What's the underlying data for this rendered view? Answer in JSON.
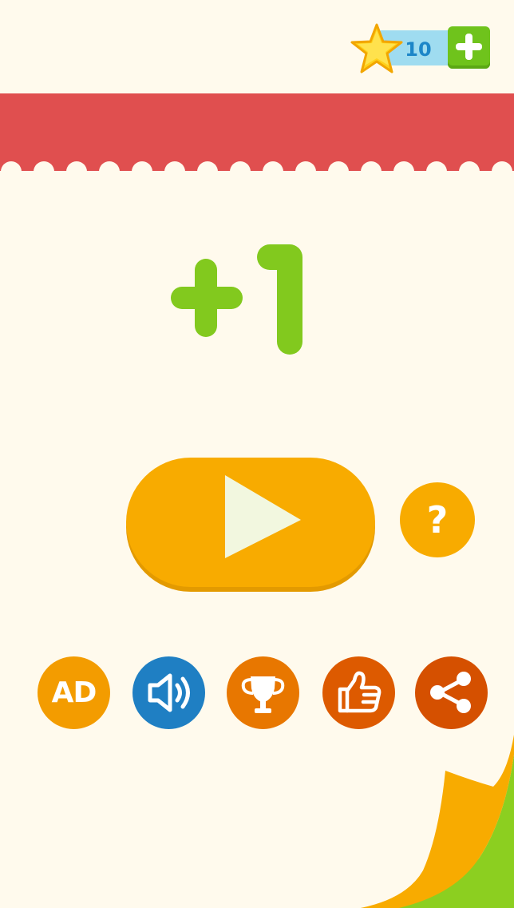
{
  "header": {
    "star_count": "10",
    "star_icon": "star-icon",
    "add_icon": "plus-icon"
  },
  "title": {
    "text": "+1",
    "color": "#82c91e"
  },
  "buttons": {
    "play_icon": "play-icon",
    "help_label": "?",
    "ad_label": "AD",
    "sound_icon": "speaker-icon",
    "trophy_icon": "trophy-icon",
    "like_icon": "thumbs-up-icon",
    "share_icon": "share-icon"
  },
  "colors": {
    "background": "#fffaed",
    "banner": "#e04f4f",
    "primary_orange": "#f8ab00",
    "green": "#6fc31c",
    "blue": "#1f7fc3",
    "star_counter_bg": "#9fdcf0"
  }
}
